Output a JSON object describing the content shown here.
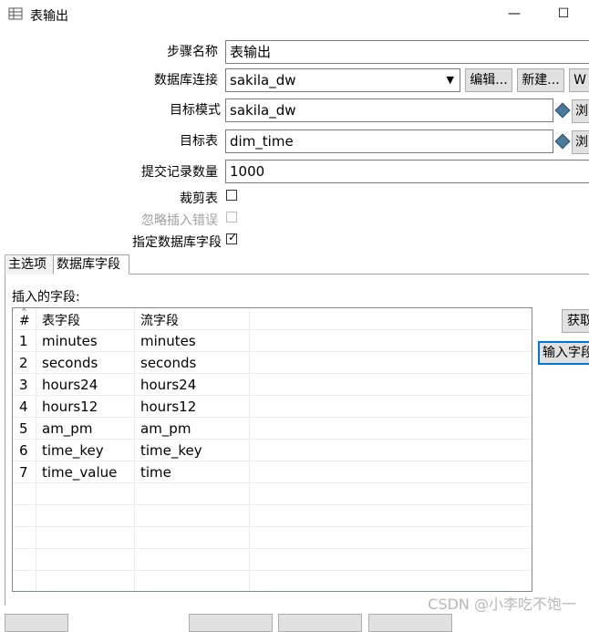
{
  "window": {
    "title": "表输出",
    "minimize_glyph": "—",
    "maximize_glyph": "☐"
  },
  "form": {
    "step_name_label": "步骤名称",
    "step_name_value": "表输出",
    "connection_label": "数据库连接",
    "connection_value": "sakila_dw",
    "edit_button": "编辑...",
    "new_button": "新建...",
    "wizard_button": "W",
    "schema_label": "目标模式",
    "schema_value": "sakila_dw",
    "browse_button": "浏",
    "table_label": "目标表",
    "table_value": "dim_time",
    "commit_label": "提交记录数量",
    "commit_value": "1000",
    "truncate_label": "裁剪表",
    "ignore_errors_label": "忽略插入错误",
    "specify_fields_label": "指定数据库字段",
    "specify_fields_checked": true,
    "truncate_checked": false,
    "ignore_errors_checked": false
  },
  "tabs": [
    {
      "label": "主选项",
      "active": false
    },
    {
      "label": "数据库字段",
      "active": true
    }
  ],
  "fields_panel": {
    "label": "插入的字段:",
    "get_fields_button": "获取",
    "input_mapping_button": "输入字段"
  },
  "table": {
    "columns": [
      "#",
      "表字段",
      "流字段"
    ],
    "rows": [
      {
        "n": "1",
        "table_field": "minutes",
        "stream_field": "minutes"
      },
      {
        "n": "2",
        "table_field": "seconds",
        "stream_field": "seconds"
      },
      {
        "n": "3",
        "table_field": "hours24",
        "stream_field": "hours24"
      },
      {
        "n": "4",
        "table_field": "hours12",
        "stream_field": "hours12"
      },
      {
        "n": "5",
        "table_field": "am_pm",
        "stream_field": "am_pm"
      },
      {
        "n": "6",
        "table_field": "time_key",
        "stream_field": "time_key"
      },
      {
        "n": "7",
        "table_field": "time_value",
        "stream_field": "time"
      }
    ]
  },
  "watermark": "CSDN @小李吃不饱一"
}
